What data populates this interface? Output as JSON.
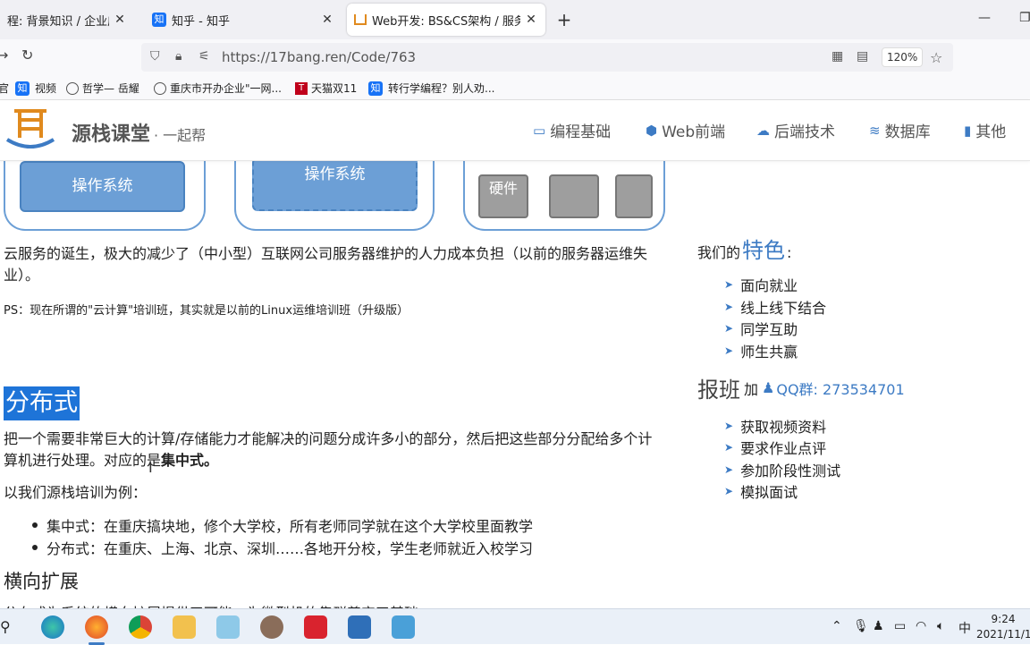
{
  "browser": {
    "tabs": [
      {
        "title": "程: 背景知识 / 企业应用",
        "active": false
      },
      {
        "title": "知乎 - 知乎",
        "active": false
      },
      {
        "title": "Web开发: BS&CS架构 / 服务器",
        "active": true
      }
    ],
    "url": "https://17bang.ren/Code/763",
    "zoom": "120%",
    "bookmarks": [
      "视频",
      "哲学— 岳耀",
      "重庆市开办企业\"一网...",
      "天猫双11",
      "转行学编程？别人劝..."
    ]
  },
  "site": {
    "brand": "源栈课堂",
    "slogan": "· 一起帮",
    "menu": [
      "编程基础",
      "Web前端",
      "后端技术",
      "数据库",
      "其他"
    ]
  },
  "diagram": {
    "os1": "操作系统",
    "os2": "操作系统",
    "hw": "硬件"
  },
  "article": {
    "p1": "云服务的诞生，极大的减少了（中小型）互联网公司服务器维护的人力成本负担（以前的服务器运维失业）。",
    "ps": "PS：现在所谓的\"云计算\"培训班，其实就是以前的Linux运维培训班（升级版）",
    "h_distributed": "分布式",
    "p2_a": "把一个需要非常巨大的计算/存储能力才能解决的问题分成许多小的部分，然后把这些部分分配给多个计算机进行处理。对应的是",
    "p2_b": "集中式。",
    "p3": "以我们源栈培训为例：",
    "bullets": [
      "集中式：在重庆搞块地，修个大学校，所有老师同学就在这个大学校里面教学",
      "分布式：在重庆、上海、北京、深圳……各地开分校，学生老师就近入校学习"
    ],
    "h_scale": "横向扩展",
    "cut": "分布式为系统的横向扩展提供了可能，为微型机的集群奠定了基础"
  },
  "sidebar": {
    "features_prefix": "我们的",
    "features_big": "特色",
    "features_suffix": ":",
    "features": [
      "面向就业",
      "线上线下结合",
      "同学互助",
      "师生共赢"
    ],
    "signup_big": "报班",
    "signup_mid": "加",
    "qq": "QQ群: 273534701",
    "signup_items": [
      "获取视频资料",
      "要求作业点评",
      "参加阶段性测试",
      "模拟面试"
    ]
  },
  "taskbar": {
    "time": "9:24",
    "date": "2021/11/1",
    "ime": "中"
  },
  "colors": {
    "accent": "#3d7bc4",
    "selection": "#1e74d8",
    "diagram": "#6c9fd6"
  }
}
